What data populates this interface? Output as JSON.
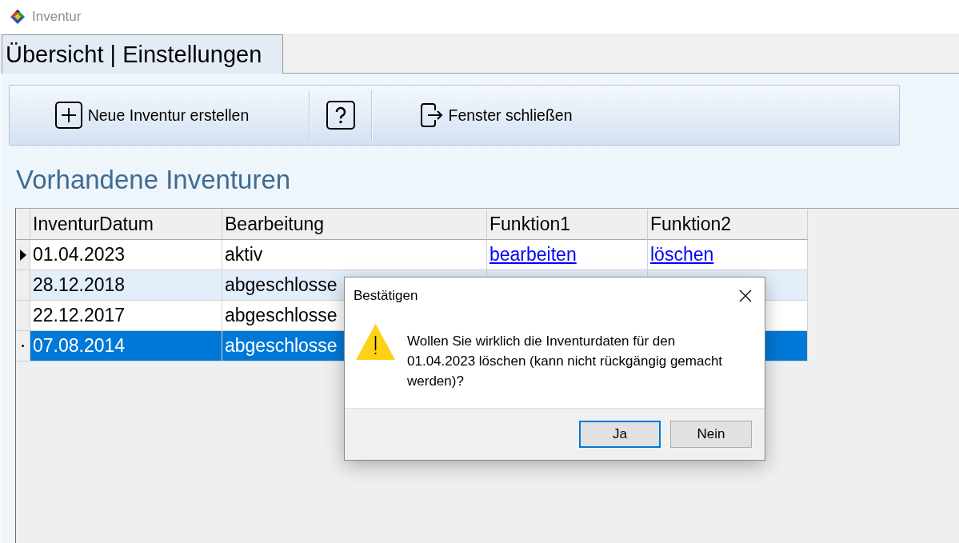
{
  "window": {
    "title": "Inventur"
  },
  "tabs": [
    {
      "label": "Übersicht | Einstellungen",
      "selected": true
    }
  ],
  "toolbar": {
    "buttons": [
      {
        "kind": "new",
        "label": "Neue Inventur erstellen"
      },
      {
        "kind": "help"
      },
      {
        "kind": "exit",
        "label": "Fenster schließen"
      }
    ]
  },
  "section_title": "Vorhandene Inventuren",
  "table": {
    "columns": [
      "InventurDatum",
      "Bearbeitung",
      "Funktion1",
      "Funktion2"
    ],
    "rows": [
      {
        "date": "01.04.2023",
        "status": "aktiv",
        "function1": "bearbeiten",
        "function2": "löschen",
        "current": true,
        "focused": false,
        "selected": false
      },
      {
        "date": "28.12.2018",
        "status": "abgeschlosse",
        "current": false,
        "focused": false,
        "selected": false
      },
      {
        "date": "22.12.2017",
        "status": "abgeschlosse",
        "current": false,
        "focused": false,
        "selected": false
      },
      {
        "date": "07.08.2014",
        "status": "abgeschlosse",
        "current": false,
        "focused": true,
        "selected": true
      }
    ]
  },
  "dialog": {
    "title": "Bestätigen",
    "message": "Wollen Sie wirklich die Inventurdaten für den 01.04.2023 löschen (kann nicht rückgängig gemacht werden)?",
    "buttons": [
      {
        "label": "Ja",
        "default": true
      },
      {
        "label": "Nein",
        "default": false
      }
    ]
  }
}
